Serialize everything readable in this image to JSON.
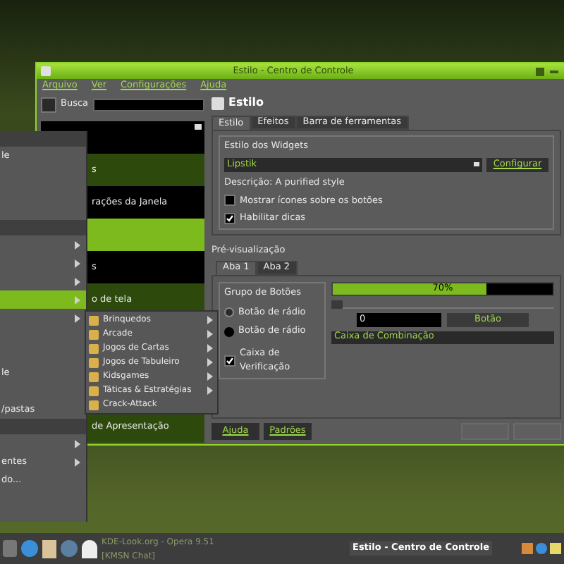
{
  "window": {
    "title": "Estilo - Centro de Controle"
  },
  "menu_bar": [
    "Arquivo",
    "Ver",
    "Configurações",
    "Ajuda"
  ],
  "search": {
    "label": "Busca"
  },
  "module_list": [
    {
      "selected": false
    },
    {
      "text": "s",
      "selected": false
    },
    {
      "text": "rações da Janela",
      "selected": false
    },
    {
      "selected": true
    },
    {
      "text": "s",
      "selected": false
    },
    {
      "text": "o de tela",
      "selected": false
    },
    {
      "text": "de Apresentação",
      "selected": false
    }
  ],
  "module": {
    "title": "Estilo"
  },
  "tabs": [
    {
      "label": "Estilo",
      "selected": true
    },
    {
      "label": "Efeitos",
      "selected": false
    },
    {
      "label": "Barra de ferramentas",
      "selected": false
    }
  ],
  "widget_style": {
    "title": "Estilo dos Widgets",
    "combo": "Lipstik",
    "configure": "Configurar",
    "description": "Descrição: A purified style",
    "options": [
      {
        "label": "Mostrar ícones sobre os botões",
        "checked": false
      },
      {
        "label": "Habilitar dicas",
        "checked": true
      }
    ]
  },
  "preview": {
    "title": "Pré-visualização",
    "tabs": [
      {
        "label": "Aba 1",
        "selected": true
      },
      {
        "label": "Aba 2",
        "selected": false
      }
    ],
    "group_title": "Grupo de Botões",
    "radios": [
      {
        "label": "Botão de rádio",
        "selected": false
      },
      {
        "label": "Botão de rádio",
        "selected": true
      }
    ],
    "checkbox": {
      "label": "Caixa de Verificação",
      "checked": true
    },
    "progress": {
      "level": 0.7,
      "reading": "70%"
    },
    "slider": {
      "level": 0.0
    },
    "spin_value": "0",
    "button": "Botão",
    "combo": "Caixa de Combinação"
  },
  "buttons": [
    {
      "label": "Ajuda",
      "disabled": false
    },
    {
      "label": "Padrões",
      "disabled": false
    },
    {
      "disabled": true
    },
    {
      "disabled": true
    }
  ],
  "start_menu": [
    {
      "kind": "header"
    },
    {
      "kind": "item",
      "text": "le",
      "arrow": false,
      "selected": false
    },
    {
      "kind": "blank"
    },
    {
      "kind": "blank"
    },
    {
      "kind": "blank"
    },
    {
      "kind": "header"
    },
    {
      "kind": "item",
      "arrow": true,
      "selected": false
    },
    {
      "kind": "item",
      "arrow": true,
      "selected": false
    },
    {
      "kind": "item",
      "arrow": true,
      "selected": false
    },
    {
      "kind": "item",
      "arrow": true,
      "selected": true
    },
    {
      "kind": "item",
      "arrow": true,
      "selected": false
    },
    {
      "kind": "blank"
    },
    {
      "kind": "blank"
    },
    {
      "kind": "item",
      "text": "le",
      "arrow": false,
      "selected": false
    },
    {
      "kind": "blank"
    },
    {
      "kind": "item",
      "text": "/pastas",
      "arrow": false,
      "selected": false
    },
    {
      "kind": "header"
    },
    {
      "kind": "item",
      "arrow": true,
      "selected": false
    },
    {
      "kind": "item",
      "text": "entes",
      "arrow": true,
      "selected": false
    },
    {
      "kind": "item",
      "text": "do...",
      "arrow": false,
      "selected": false
    }
  ],
  "submenu": [
    {
      "text": "Brinquedos",
      "arrow": true
    },
    {
      "text": "Arcade",
      "arrow": true
    },
    {
      "text": "Jogos de Cartas",
      "arrow": true
    },
    {
      "text": "Jogos de Tabuleiro",
      "arrow": true
    },
    {
      "text": "Kidsgames",
      "arrow": true
    },
    {
      "text": "Táticas & Estratégias",
      "arrow": true
    },
    {
      "text": "Crack-Attack",
      "arrow": false
    }
  ],
  "taskbar": {
    "tasks": [
      {
        "text": "KDE-Look.org - Opera 9.51",
        "active": false
      },
      {
        "text": "[KMSN Chat]",
        "active": false
      },
      {
        "text": "Estilo - Centro de Controle",
        "active": true
      }
    ]
  }
}
